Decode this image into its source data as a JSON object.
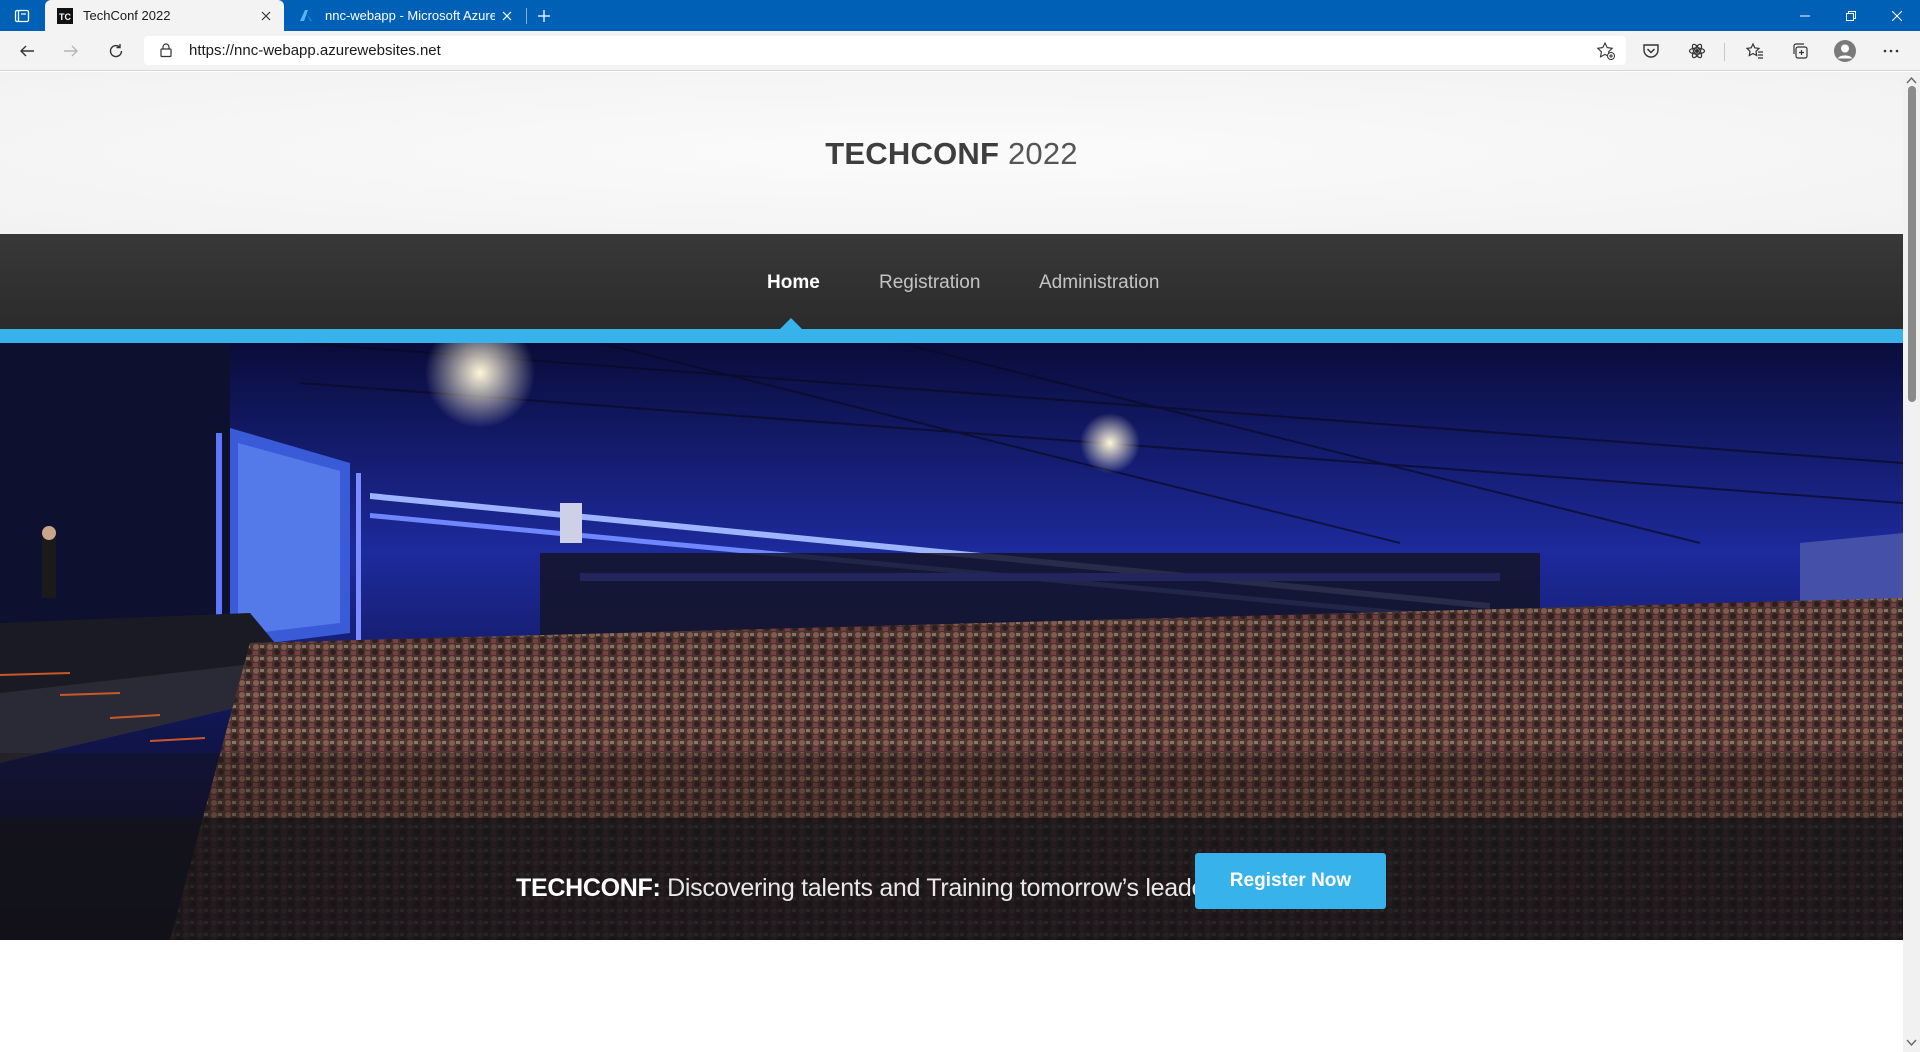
{
  "browser": {
    "tabs": [
      {
        "title": "TechConf 2022",
        "favicon": "TC",
        "active": true
      },
      {
        "title": "nnc-webapp - Microsoft Azure",
        "favicon": "azure-icon",
        "active": false
      }
    ],
    "url": "https://nnc-webapp.azurewebsites.net"
  },
  "site": {
    "title_bold": "TECHCONF",
    "title_light": "2022",
    "nav": [
      {
        "label": "Home",
        "current": true
      },
      {
        "label": "Registration",
        "current": false
      },
      {
        "label": "Administration",
        "current": false
      }
    ],
    "hero": {
      "brand": "TECHCONF:",
      "tagline": "Discovering talents and Training tomorrow’s leaders",
      "cta_label": "Register Now"
    }
  },
  "colors": {
    "titlebar": "#0060b6",
    "accent": "#37b2ea",
    "nav_bg": "#2f2f2f"
  }
}
